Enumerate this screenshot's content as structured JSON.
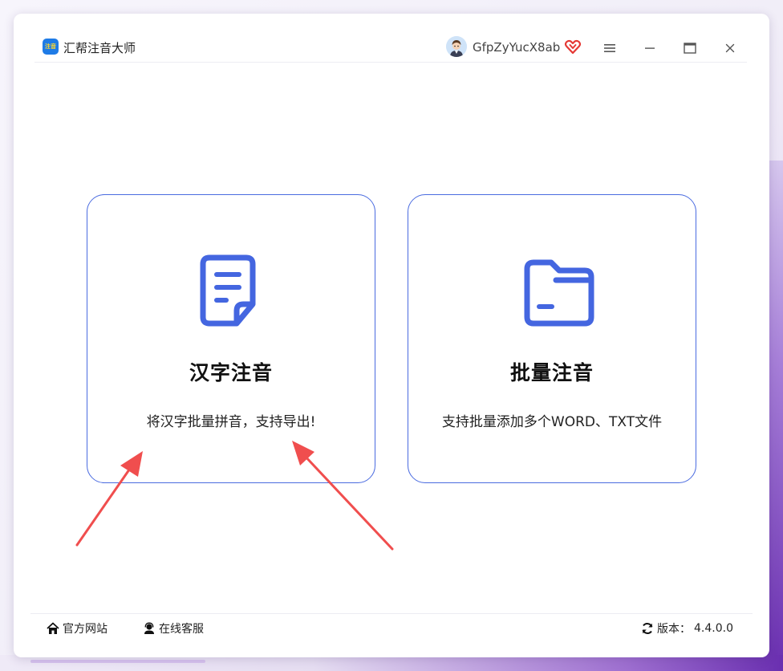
{
  "app": {
    "title": "汇帮注音大师",
    "logo_text": "注音",
    "username": "GfpZyYucX8ab"
  },
  "window_controls": {
    "menu_icon": "hamburger-menu-icon",
    "minimize_icon": "minimize-icon",
    "maximize_icon": "maximize-icon",
    "close_icon": "close-icon"
  },
  "cards": [
    {
      "title": "汉字注音",
      "description": "将汉字批量拼音，支持导出!",
      "icon": "document-icon"
    },
    {
      "title": "批量注音",
      "description": "支持批量添加多个WORD、TXT文件",
      "icon": "folder-icon"
    }
  ],
  "footer": {
    "website_label": "官方网站",
    "support_label": "在线客服",
    "version_label": "版本：",
    "version_value": "4.4.0.0"
  },
  "colors": {
    "accent": "#4466E0",
    "card_border": "#4A6BE0",
    "annotation_arrow": "#F04E4E",
    "vip": "#E53935"
  }
}
